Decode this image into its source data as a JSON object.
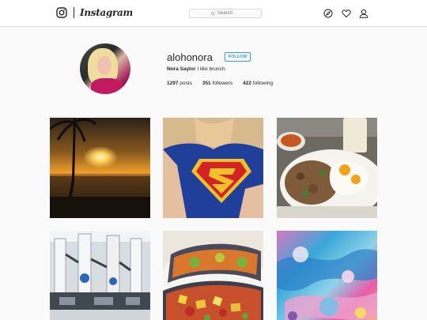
{
  "header": {
    "logo_text": "Instagram",
    "search": {
      "placeholder": "Search"
    },
    "icons": [
      "instagram-logo-icon",
      "search-icon",
      "compass-icon",
      "heart-icon",
      "user-icon"
    ]
  },
  "profile": {
    "username": "alohonora",
    "follow_label": "FOLLOW",
    "full_name": "Nora Saylor",
    "bio": "I like brunch.",
    "stats": {
      "posts_count": "1297",
      "posts_label": "posts",
      "followers_count": "351",
      "followers_label": "followers",
      "following_count": "422",
      "following_label": "following"
    }
  },
  "colors": {
    "accent": "#3897f0",
    "text": "#262626",
    "border": "#dbdbdb",
    "background": "#fafafa"
  },
  "posts": [
    "sunset-palm-tree",
    "superman-shirt",
    "eggs-breakfast-plate",
    "robotic-machinery",
    "tacos-plate",
    "colorful-bath-bomb"
  ]
}
